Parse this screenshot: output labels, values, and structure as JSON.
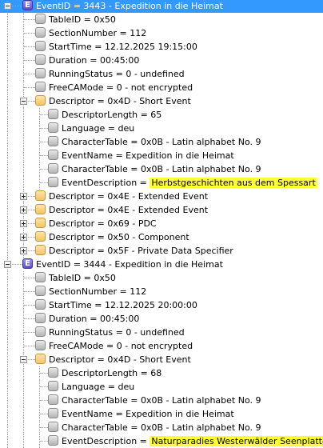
{
  "tree": {
    "rows": [
      {
        "depth": 0,
        "icon": "event-icon",
        "expander": "minus",
        "text": "EventID = 3443 - Expedition in die Heimat",
        "selected": true
      },
      {
        "depth": 1,
        "icon": "item-icon",
        "text": "TableID = 0x50"
      },
      {
        "depth": 1,
        "icon": "item-icon",
        "text": "SectionNumber = 112"
      },
      {
        "depth": 1,
        "icon": "item-icon",
        "text": "StartTime = 12.12.2025 19:15:00"
      },
      {
        "depth": 1,
        "icon": "item-icon",
        "text": "Duration = 00:45:00"
      },
      {
        "depth": 1,
        "icon": "item-icon",
        "text": "RunningStatus = 0 - undefined"
      },
      {
        "depth": 1,
        "icon": "item-icon",
        "text": "FreeCAMode = 0 - not encrypted"
      },
      {
        "depth": 1,
        "icon": "folder-icon",
        "expander": "minus",
        "text": "Descriptor = 0x4D - Short Event"
      },
      {
        "depth": 2,
        "icon": "item-icon",
        "text": "DescriptorLength = 65"
      },
      {
        "depth": 2,
        "icon": "item-icon",
        "text": "Language = deu"
      },
      {
        "depth": 2,
        "icon": "item-icon",
        "text": "CharacterTable = 0x0B - Latin alphabet No. 9"
      },
      {
        "depth": 2,
        "icon": "item-icon",
        "text": "EventName = Expedition in die Heimat"
      },
      {
        "depth": 2,
        "icon": "item-icon",
        "text": "CharacterTable = 0x0B - Latin alphabet No. 9"
      },
      {
        "depth": 2,
        "icon": "item-icon",
        "text": "EventDescription = ",
        "highlight": "Herbstgeschichten aus dem Spessart"
      },
      {
        "depth": 1,
        "icon": "folder-icon",
        "expander": "plus",
        "text": "Descriptor = 0x4E - Extended Event"
      },
      {
        "depth": 1,
        "icon": "folder-icon",
        "expander": "plus",
        "text": "Descriptor = 0x4E - Extended Event"
      },
      {
        "depth": 1,
        "icon": "folder-icon",
        "expander": "plus",
        "text": "Descriptor = 0x69 - PDC"
      },
      {
        "depth": 1,
        "icon": "folder-icon",
        "expander": "plus",
        "text": "Descriptor = 0x50 - Component"
      },
      {
        "depth": 1,
        "icon": "folder-icon",
        "expander": "plus",
        "text": "Descriptor = 0x5F - Private Data Specifier"
      },
      {
        "depth": 0,
        "icon": "event-icon",
        "expander": "minus",
        "text": "EventID = 3444 - Expedition in die Heimat"
      },
      {
        "depth": 1,
        "icon": "item-icon",
        "text": "TableID = 0x50"
      },
      {
        "depth": 1,
        "icon": "item-icon",
        "text": "SectionNumber = 112"
      },
      {
        "depth": 1,
        "icon": "item-icon",
        "text": "StartTime = 12.12.2025 20:00:00"
      },
      {
        "depth": 1,
        "icon": "item-icon",
        "text": "Duration = 00:45:00"
      },
      {
        "depth": 1,
        "icon": "item-icon",
        "text": "RunningStatus = 0 - undefined"
      },
      {
        "depth": 1,
        "icon": "item-icon",
        "text": "FreeCAMode = 0 - not encrypted"
      },
      {
        "depth": 1,
        "icon": "folder-icon",
        "expander": "minus",
        "text": "Descriptor = 0x4D - Short Event"
      },
      {
        "depth": 2,
        "icon": "item-icon",
        "text": "DescriptorLength = 68"
      },
      {
        "depth": 2,
        "icon": "item-icon",
        "text": "Language = deu"
      },
      {
        "depth": 2,
        "icon": "item-icon",
        "text": "CharacterTable = 0x0B - Latin alphabet No. 9"
      },
      {
        "depth": 2,
        "icon": "item-icon",
        "text": "EventName = Expedition in die Heimat"
      },
      {
        "depth": 2,
        "icon": "item-icon",
        "text": "CharacterTable = 0x0B - Latin alphabet No. 9"
      },
      {
        "depth": 2,
        "icon": "item-icon",
        "text": "EventDescription = ",
        "highlight": "Naturparadies Westerwälder Seenplatte"
      }
    ],
    "event_icon_letter": "E",
    "colors": {
      "selection": "#3399ff",
      "highlight": "#ffff33"
    }
  }
}
